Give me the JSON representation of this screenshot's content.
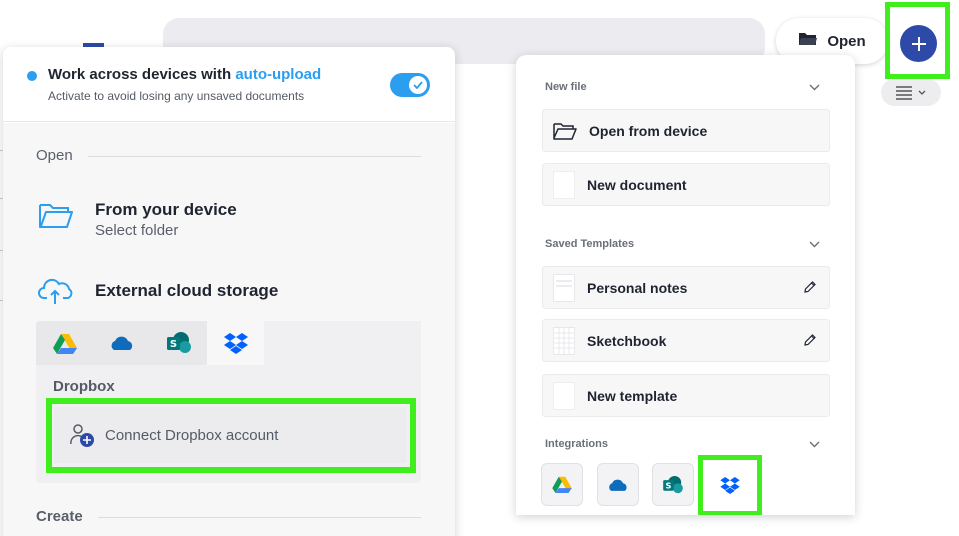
{
  "header": {
    "open_label": "Open",
    "plus_label": "+"
  },
  "left_panel": {
    "banner": {
      "title": "Work across devices with",
      "title_link": "auto-upload",
      "subtitle": "Activate to avoid losing any unsaved documents",
      "toggle_on": true
    },
    "open_section": {
      "heading": "Open",
      "device_title": "From your device",
      "device_subtitle": "Select folder",
      "cloud_title": "External cloud storage",
      "tabs": [
        {
          "name": "google-drive",
          "icon": "google-drive-icon"
        },
        {
          "name": "onedrive",
          "icon": "onedrive-icon"
        },
        {
          "name": "sharepoint",
          "icon": "sharepoint-icon"
        },
        {
          "name": "dropbox",
          "icon": "dropbox-icon",
          "active": true
        }
      ],
      "selected_provider": "Dropbox",
      "connect_label": "Connect Dropbox account"
    },
    "create_heading": "Create"
  },
  "right_panel": {
    "new_file": {
      "heading": "New file",
      "items": [
        {
          "label": "Open from device",
          "icon": "folder-icon"
        },
        {
          "label": "New document",
          "icon": "document-icon"
        }
      ]
    },
    "saved_templates": {
      "heading": "Saved Templates",
      "items": [
        {
          "label": "Personal notes",
          "icon": "notes-thumbnail",
          "editable": true
        },
        {
          "label": "Sketchbook",
          "icon": "grid-thumbnail",
          "editable": true
        },
        {
          "label": "New template",
          "icon": "template-thumbnail",
          "editable": false
        }
      ]
    },
    "integrations": {
      "heading": "Integrations",
      "items": [
        "google-drive-icon",
        "onedrive-icon",
        "sharepoint-icon",
        "dropbox-icon"
      ]
    }
  },
  "colors": {
    "accent": "#2b9ef0",
    "brand": "#2e4aa8",
    "highlight": "#40ee1e"
  }
}
